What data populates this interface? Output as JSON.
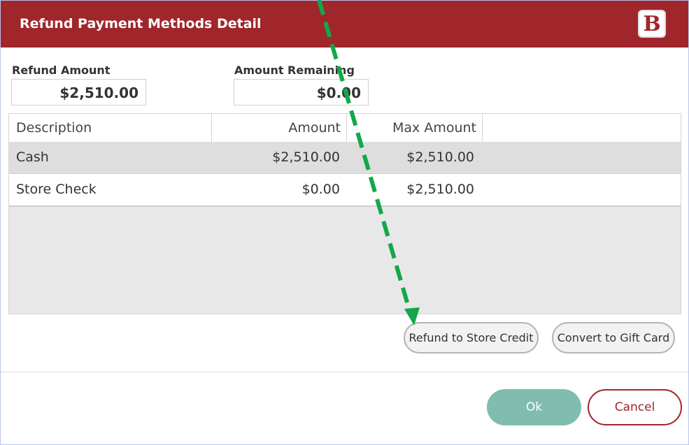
{
  "dialog": {
    "title": "Refund Payment Methods Detail",
    "logo_letters": "B",
    "colors": {
      "titlebar": "#a0262b",
      "ok": "#80bcb0",
      "cancel_border": "#a0262b",
      "arrow": "#12a84a"
    }
  },
  "fields": {
    "refund_amount_label": "Refund Amount",
    "refund_amount_value": "$2,510.00",
    "amount_remaining_label": "Amount Remaining",
    "amount_remaining_value": "$0.00"
  },
  "table": {
    "headers": [
      "Description",
      "Amount",
      "Max Amount"
    ],
    "rows": [
      {
        "description": "Cash",
        "amount": "$2,510.00",
        "max_amount": "$2,510.00"
      },
      {
        "description": "Store Check",
        "amount": "$0.00",
        "max_amount": "$2,510.00"
      }
    ]
  },
  "actions": {
    "refund_store_credit": "Refund to Store Credit",
    "convert_gift_card": "Convert to Gift Card",
    "ok": "Ok",
    "cancel": "Cancel"
  }
}
